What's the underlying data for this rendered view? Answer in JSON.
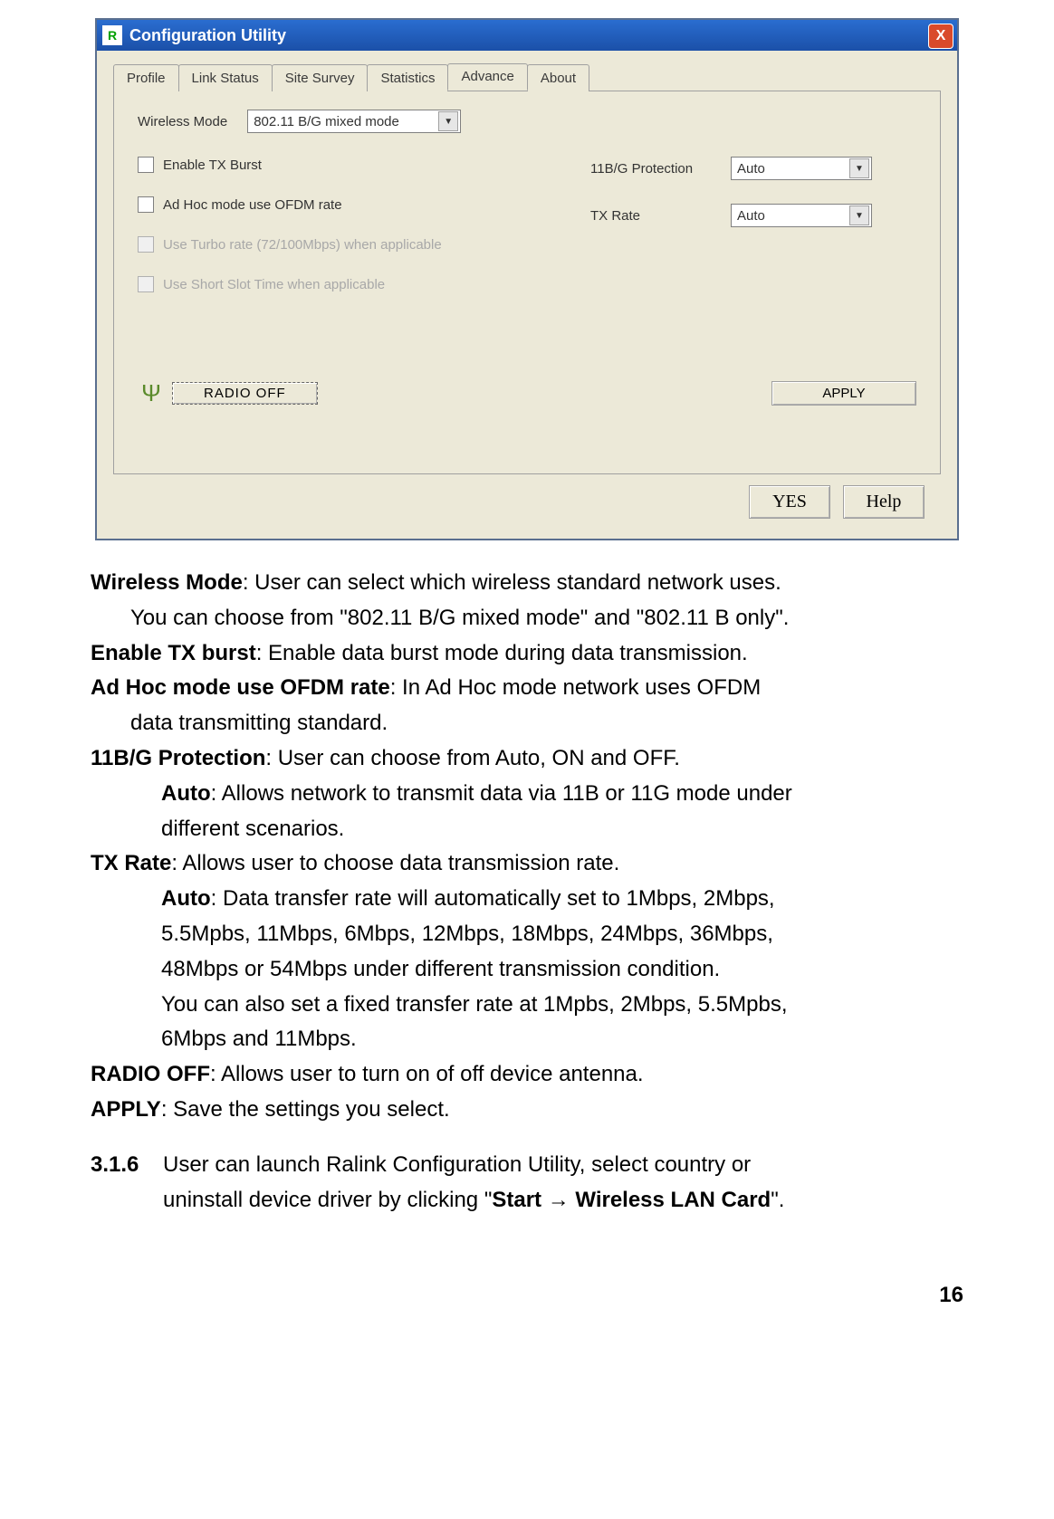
{
  "titlebar": {
    "title": "Configuration Utility",
    "icon_letter": "R",
    "close": "X"
  },
  "tabs": [
    "Profile",
    "Link Status",
    "Site Survey",
    "Statistics",
    "Advance",
    "About"
  ],
  "active_tab_index": 4,
  "panel": {
    "wireless_mode_label": "Wireless Mode",
    "wireless_mode_value": "802.11 B/G mixed mode",
    "enable_tx_burst": "Enable TX Burst",
    "ad_hoc_ofdm": "Ad Hoc mode use OFDM rate",
    "turbo_rate": "Use Turbo rate (72/100Mbps) when applicable",
    "short_slot": "Use Short Slot Time when applicable",
    "protection_label": "11B/G Protection",
    "protection_value": "Auto",
    "tx_rate_label": "TX Rate",
    "tx_rate_value": "Auto",
    "radio_off": "RADIO OFF",
    "apply": "APPLY"
  },
  "dialog": {
    "yes": "YES",
    "help": "Help"
  },
  "doc": {
    "l1b": "Wireless Mode",
    "l1": ": User can select which wireless standard network uses.",
    "l2": "You can choose from \"802.11 B/G mixed mode\" and \"802.11 B only\".",
    "l3b": "Enable TX burst",
    "l3": ": Enable data burst mode during data transmission.",
    "l4b": "Ad Hoc mode use OFDM rate",
    "l4": ": In Ad Hoc mode network uses OFDM",
    "l5": "data transmitting standard.",
    "l6b": "11B/G Protection",
    "l6": ": User can choose from Auto, ON and OFF.",
    "l7b": "Auto",
    "l7": ": Allows network to transmit data via 11B or 11G mode under",
    "l8": "different scenarios.",
    "l9b": "TX Rate",
    "l9": ": Allows user to choose data transmission rate.",
    "l10b": "Auto",
    "l10": ": Data transfer rate will automatically set to 1Mbps, 2Mbps,",
    "l11": "5.5Mpbs, 11Mbps, 6Mbps, 12Mbps, 18Mbps, 24Mbps, 36Mbps,",
    "l12": "48Mbps or 54Mbps under different transmission condition.",
    "l13": "You can also set a fixed transfer rate at 1Mpbs, 2Mbps, 5.5Mpbs,",
    "l14": "6Mbps and 11Mbps.",
    "l15b": "RADIO OFF",
    "l15": ": Allows user to turn on of off device antenna.",
    "l16b": "APPLY",
    "l16": ": Save the settings you select.",
    "sec_num": "3.1.6",
    "sec1": "User can launch Ralink Configuration Utility, select country or",
    "sec2a": "uninstall device driver by clicking \"",
    "sec2b": "Start ",
    "sec2c": " Wireless LAN Card",
    "sec2d": "\".",
    "arrow": "→"
  },
  "page_number": "16"
}
